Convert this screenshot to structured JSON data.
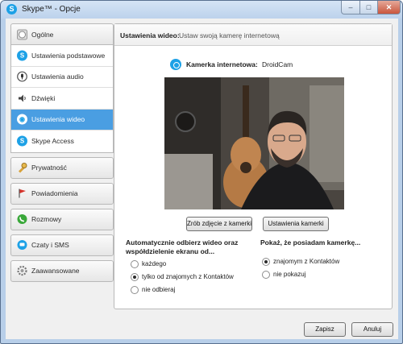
{
  "window": {
    "title": "Skype™ - Opcje",
    "app_icon": "S",
    "minimize_glyph": "–",
    "maximize_glyph": "□",
    "close_glyph": "✕"
  },
  "sidebar": {
    "general_group": {
      "label": "Ogólne",
      "icon": "skype-logo-icon",
      "items": [
        {
          "label": "Ustawienia podstawowe",
          "icon": "skype-logo-icon",
          "selected": false
        },
        {
          "label": "Ustawienia audio",
          "icon": "microphone-icon",
          "selected": false
        },
        {
          "label": "Dźwięki",
          "icon": "speaker-icon",
          "selected": false
        },
        {
          "label": "Ustawienia wideo",
          "icon": "webcam-icon",
          "selected": true
        },
        {
          "label": "Skype Access",
          "icon": "skype-logo-icon",
          "selected": false
        }
      ]
    },
    "other_groups": [
      {
        "label": "Prywatność",
        "icon": "lock-icon"
      },
      {
        "label": "Powiadomienia",
        "icon": "flag-icon"
      },
      {
        "label": "Rozmowy",
        "icon": "phone-icon"
      },
      {
        "label": "Czaty i SMS",
        "icon": "chat-icon"
      },
      {
        "label": "Zaawansowane",
        "icon": "gear-icon"
      }
    ]
  },
  "panel": {
    "title": "Ustawienia wideo:",
    "subtitle": "Ustaw swoją kamerę internetową",
    "camera_label": "Kamerka internetowa:",
    "camera_value": "DroidCam",
    "snapshot_button": "Zrób zdjęcie z kamerki",
    "camera_settings_button": "Ustawienia kamerki",
    "auto_receive": {
      "heading": "Automatycznie odbierz wideo oraz współdzielenie ekranu od...",
      "options": [
        "każdego",
        "tylko od znajomych z Kontaktów",
        "nie odbieraj"
      ],
      "selected_index": 1
    },
    "show_camera": {
      "heading": "Pokaż, że posiadam kamerkę...",
      "options": [
        "znajomym z Kontaktów",
        "nie pokazuj"
      ],
      "selected_index": 0
    }
  },
  "footer": {
    "save_button": "Zapisz",
    "cancel_button": "Anuluj"
  },
  "colors": {
    "selected_item": "#4a9ee2",
    "skype_blue": "#1da1e6",
    "window_frame": "#b8cfe9"
  }
}
